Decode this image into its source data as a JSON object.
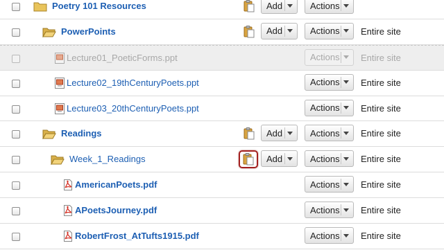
{
  "colors": {
    "link": "#1d5fb3",
    "dim_text": "#a8a8a8",
    "highlight": "#a3201f"
  },
  "rows": [
    {
      "name": "Poetry 101 Resources",
      "type": "folder",
      "icon": "folder-icon",
      "add_label": "Add",
      "actions_label": "Actions",
      "access": ""
    },
    {
      "name": "PowerPoints",
      "type": "folder-open",
      "icon": "folder-open-icon",
      "add_label": "Add",
      "actions_label": "Actions",
      "access": "Entire site"
    },
    {
      "name": "Lecture01_PoeticForms.ppt",
      "type": "ppt",
      "icon": "ppt-file-icon",
      "actions_label": "Actions",
      "access": "Entire site",
      "disabled": true
    },
    {
      "name": "Lecture02_19thCenturyPoets.ppt",
      "type": "ppt",
      "icon": "ppt-file-icon",
      "actions_label": "Actions",
      "access": "Entire site"
    },
    {
      "name": "Lecture03_20thCenturyPoets.ppt",
      "type": "ppt",
      "icon": "ppt-file-icon",
      "actions_label": "Actions",
      "access": "Entire site"
    },
    {
      "name": "Readings",
      "type": "folder-open",
      "icon": "folder-open-icon",
      "add_label": "Add",
      "actions_label": "Actions",
      "access": "Entire site"
    },
    {
      "name": "Week_1_Readings",
      "type": "folder-open",
      "icon": "folder-open-icon",
      "add_label": "Add",
      "actions_label": "Actions",
      "access": "Entire site",
      "paste_highlighted": true
    },
    {
      "name": "AmericanPoets.pdf",
      "type": "pdf",
      "icon": "pdf-file-icon",
      "actions_label": "Actions",
      "access": "Entire site"
    },
    {
      "name": "APoetsJourney.pdf",
      "type": "pdf",
      "icon": "pdf-file-icon",
      "actions_label": "Actions",
      "access": "Entire site"
    },
    {
      "name": "RobertFrost_AtTufts1915.pdf",
      "type": "pdf",
      "icon": "pdf-file-icon",
      "actions_label": "Actions",
      "access": "Entire site"
    }
  ]
}
